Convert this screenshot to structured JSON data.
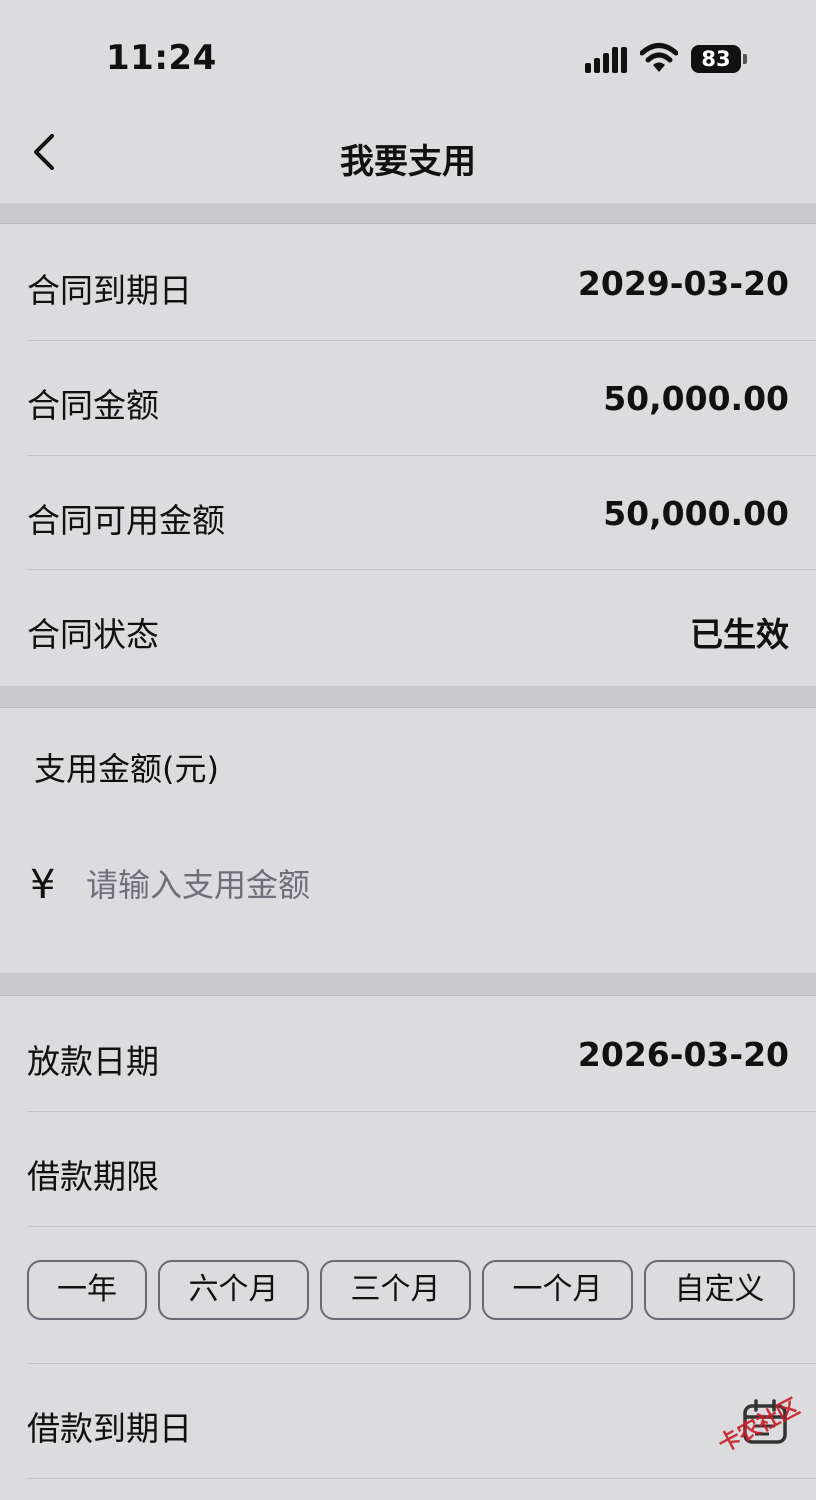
{
  "status_bar": {
    "time": "11:24",
    "battery": "83"
  },
  "nav": {
    "title": "我要支用"
  },
  "contract": {
    "rows": [
      {
        "label": "合同到期日",
        "value": "2029-03-20"
      },
      {
        "label": "合同金额",
        "value": "50,000.00"
      },
      {
        "label": "合同可用金额",
        "value": "50,000.00"
      },
      {
        "label": "合同状态",
        "value": "已生效"
      }
    ]
  },
  "amount": {
    "title": "支用金额(元)",
    "currency_symbol": "¥",
    "placeholder": "请输入支用金额",
    "value": ""
  },
  "loan": {
    "release_date_label": "放款日期",
    "release_date_value": "2026-03-20",
    "term_label": "借款期限",
    "term_options": [
      "一年",
      "六个月",
      "三个月",
      "一个月",
      "自定义"
    ],
    "due_date_label": "借款到期日"
  },
  "watermark": {
    "text": "卡农社区"
  },
  "colors": {
    "background": "#dcdcde",
    "band": "#cacacc",
    "button_border": "#6a6a74",
    "watermark": "#c8202a"
  }
}
